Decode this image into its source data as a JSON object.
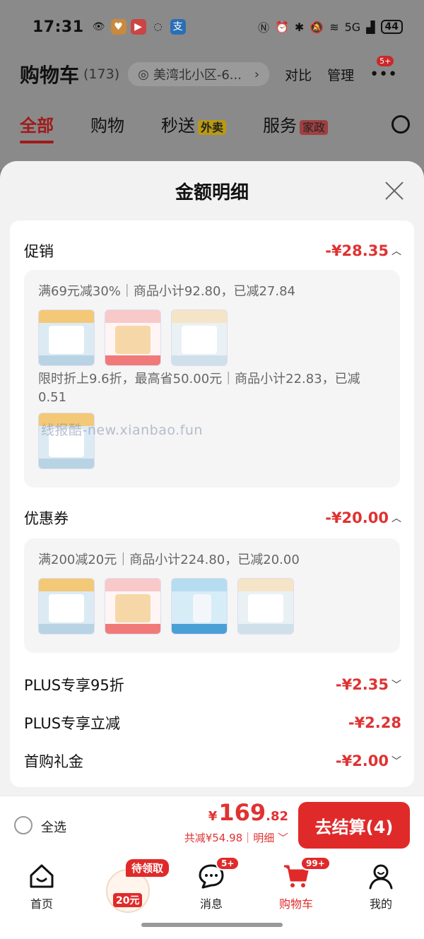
{
  "status_bar": {
    "time": "17:31",
    "network": "5G",
    "battery": "44"
  },
  "header": {
    "title": "购物车",
    "count": "(173)",
    "address": "美湾北小区-6...",
    "compare": "对比",
    "manage": "管理",
    "more_badge": "5+"
  },
  "tabs": [
    {
      "label": "全部"
    },
    {
      "label": "购物"
    },
    {
      "label": "秒送",
      "badge": "外卖"
    },
    {
      "label": "服务",
      "badge": "家政"
    }
  ],
  "sheet": {
    "title": "金额明细",
    "promo": {
      "label": "促销",
      "amount": "-¥28.35",
      "rule1": "满69元减30%｜商品小计92.80，已减27.84",
      "rule2": "限时折上9.6折，最高省50.00元｜商品小计22.83，已减0.51"
    },
    "coupon": {
      "label": "优惠券",
      "amount": "-¥20.00",
      "rule": "满200减20元｜商品小计224.80，已减20.00"
    },
    "plus95": {
      "label": "PLUS专享95折",
      "amount": "-¥2.35"
    },
    "plus_cut": {
      "label": "PLUS专享立减",
      "amount": "-¥2.28"
    },
    "first": {
      "label": "首购礼金",
      "amount": "-¥2.00"
    }
  },
  "watermark": "线报酷-new.xianbao.fun",
  "checkout": {
    "select_all": "全选",
    "currency": "¥",
    "price_int": "169",
    "price_dec": ".82",
    "savings": "共减¥54.98｜明细",
    "pay_button": "去结算(4)"
  },
  "nav": {
    "home": "首页",
    "coupon_tag": "待领取",
    "coupon_amount": "20元",
    "messages": "消息",
    "messages_badge": "5+",
    "cart": "购物车",
    "cart_badge": "99+",
    "mine": "我的"
  },
  "colors": {
    "accent": "#e02a2a",
    "amount": "#e03232"
  }
}
